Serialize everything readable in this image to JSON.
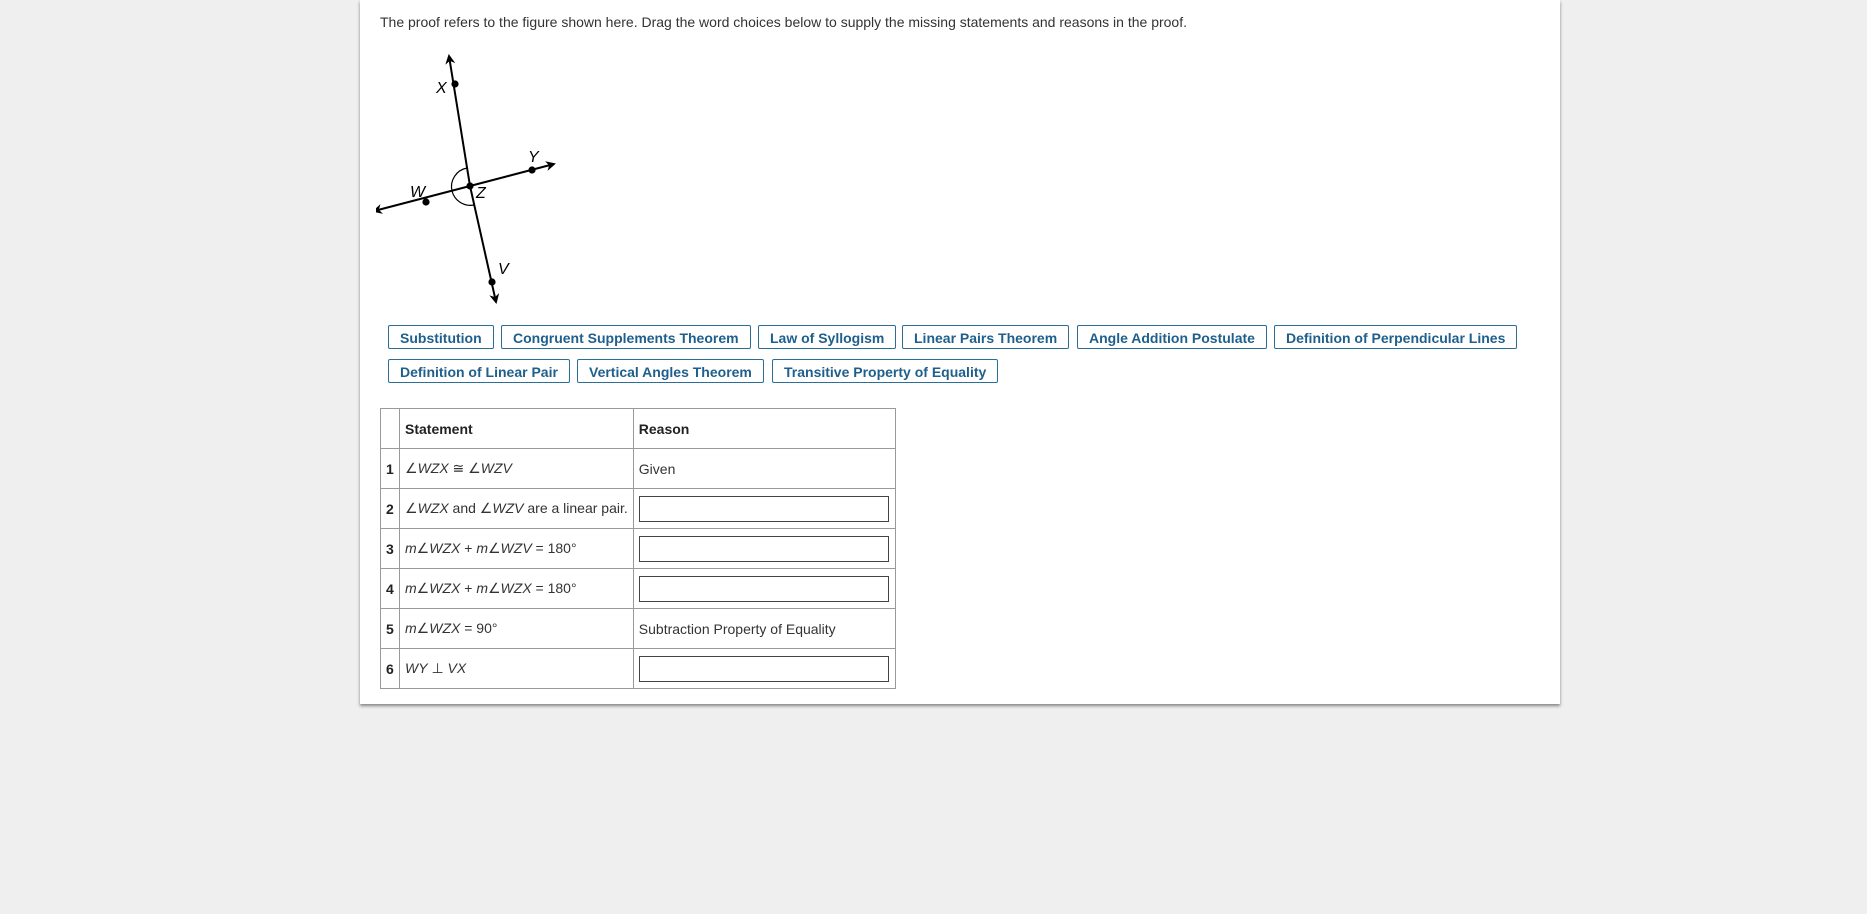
{
  "instructions": "The proof refers to the figure shown here. Drag the word choices below to supply the missing statements and reasons in the proof.",
  "figure": {
    "labels": {
      "x": "X",
      "y": "Y",
      "w": "W",
      "z": "Z",
      "v": "V"
    }
  },
  "choices": [
    "Substitution",
    "Congruent Supplements Theorem",
    "Law of Syllogism",
    "Linear Pairs Theorem",
    "Angle Addition Postulate",
    "Definition of Perpendicular Lines",
    "Definition of Linear Pair",
    "Vertical Angles Theorem",
    "Transitive Property of Equality"
  ],
  "table": {
    "header_statement": "Statement",
    "header_reason": "Reason",
    "rows": [
      {
        "num": "1",
        "statement_html": "∠<i>WZX</i> ≅ ∠<i>WZV</i>",
        "reason": "Given",
        "drop": false
      },
      {
        "num": "2",
        "statement_html": "∠<i>WZX</i> and ∠<i>WZV</i> are a linear pair.",
        "reason": "",
        "drop": true
      },
      {
        "num": "3",
        "statement_html": "<i>m</i>∠<i>WZX</i> + <i>m</i>∠<i>WZV</i> = 180°",
        "reason": "",
        "drop": true
      },
      {
        "num": "4",
        "statement_html": "<i>m</i>∠<i>WZX</i> + <i>m</i>∠<i>WZX</i> = 180°",
        "reason": "",
        "drop": true
      },
      {
        "num": "5",
        "statement_html": "<i>m</i>∠<i>WZX</i> = 90°",
        "reason": "Subtraction Property of Equality",
        "drop": false
      },
      {
        "num": "6",
        "statement_html": "<i>WY</i> ⊥ <i>VX</i>",
        "reason": "",
        "drop": true
      }
    ]
  },
  "colors": {
    "chip_border": "#2a6f97",
    "chip_text": "#1f5f8b",
    "background": "#efefef"
  }
}
